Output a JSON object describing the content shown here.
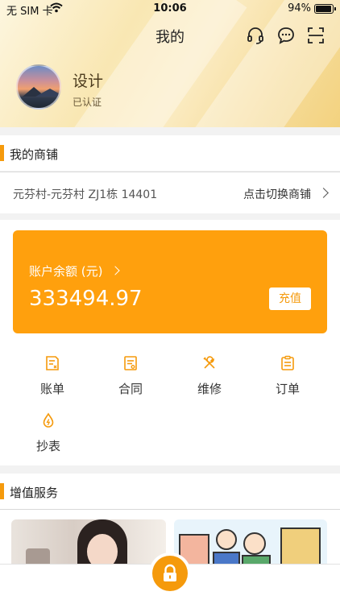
{
  "status_bar": {
    "carrier": "无 SIM 卡",
    "time": "10:06",
    "battery_pct": "94%",
    "battery_level": 0.94
  },
  "navbar": {
    "title": "我的",
    "icons": [
      "headset-icon",
      "chat-bubble-icon",
      "scan-icon"
    ]
  },
  "profile": {
    "name": "设计",
    "verification": "已认证"
  },
  "my_shop": {
    "section_title": "我的商铺",
    "address": "元芬村-元芬村 ZJ1栋 14401",
    "switch_label": "点击切换商铺"
  },
  "balance": {
    "label": "账户余额 (元)",
    "amount": "333494.97",
    "recharge_label": "充值"
  },
  "services": [
    {
      "label": "账单",
      "icon": "bill-icon"
    },
    {
      "label": "合同",
      "icon": "contract-icon"
    },
    {
      "label": "维修",
      "icon": "repair-tools-icon"
    },
    {
      "label": "订单",
      "icon": "order-clipboard-icon"
    },
    {
      "label": "抄表",
      "icon": "meter-drop-icon"
    }
  ],
  "value_added": {
    "section_title": "增值服务"
  },
  "tabbar": {
    "center_icon": "lock-icon"
  },
  "colors": {
    "accent": "#F59A0C",
    "card": "#FFA00D",
    "hero_gold": "#F6DC9A"
  }
}
